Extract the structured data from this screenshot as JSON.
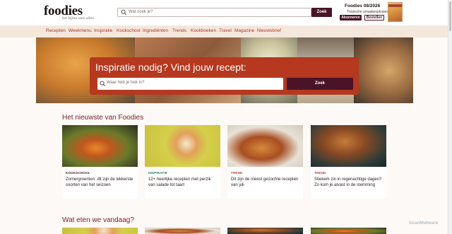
{
  "header": {
    "logo": "foodies",
    "tagline": "tot bijna van alles",
    "search_placeholder": "Wat zoek je?",
    "search_button": "Zoek",
    "magazine_title": "Foodies 08/2026",
    "magazine_subtitle": "Tropische smaakexplosies",
    "subscribe_button": "Abonneren",
    "order_button": "Bestellen"
  },
  "nav": {
    "items": [
      "Recepten",
      "Weekmenu",
      "Inspiratie",
      "Kookschool",
      "Ingrediënten",
      "Trends",
      "Kookboeken",
      "Travel",
      "Magazine",
      "Nieuwsbrief"
    ]
  },
  "hero": {
    "title": "Inspiratie nodig? Vind jouw recept:",
    "search_placeholder": "Waar heb je trek in?",
    "search_button": "Zoek"
  },
  "news": {
    "heading": "Het nieuwste van Foodies",
    "cards": [
      {
        "tag": "KOOKSCHOOL",
        "tag_color": "#4a1426",
        "title": "Zomergroenten: dit zijn de lekkerste soorten van het seizoen"
      },
      {
        "tag": "INSPIRATIE",
        "tag_color": "#1f7a4a",
        "title": "12+ heerlijke recepten met perzik: van salade tot taart"
      },
      {
        "tag": "TREND",
        "tag_color": "#c0392b",
        "title": "Dit zijn de meest gezochte recepten van juli"
      },
      {
        "tag": "TREND",
        "tag_color": "#c0392b",
        "title": "Stiekem zin in regenachtige dagen? Zo kom je alvast in de stemming"
      }
    ]
  },
  "today": {
    "heading": "Wat eten we vandaag?"
  },
  "watermark": "ScanMalware",
  "colors": {
    "brand_dark": "#4a1426",
    "accent_red": "#b5381f",
    "nav_bg": "#f4e7dc",
    "nav_text": "#b0382a"
  }
}
